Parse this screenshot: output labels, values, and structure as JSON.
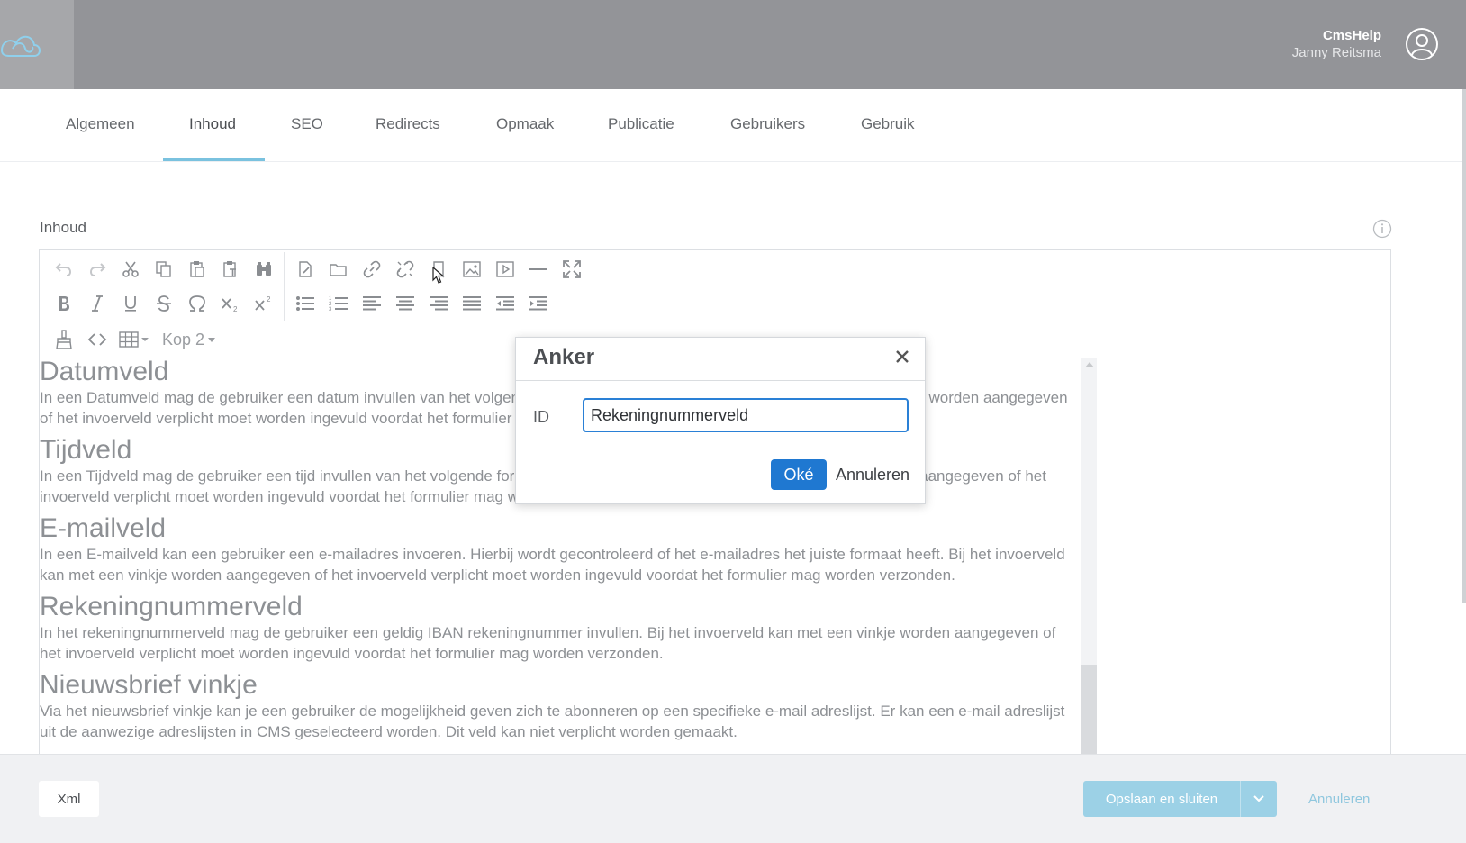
{
  "header": {
    "app_name": "CmsHelp",
    "user_name": "Janny Reitsma"
  },
  "tabs": [
    {
      "label": "Algemeen",
      "active": false
    },
    {
      "label": "Inhoud",
      "active": true
    },
    {
      "label": "SEO",
      "active": false
    },
    {
      "label": "Redirects",
      "active": false
    },
    {
      "label": "Opmaak",
      "active": false
    },
    {
      "label": "Publicatie",
      "active": false
    },
    {
      "label": "Gebruikers",
      "active": false
    },
    {
      "label": "Gebruik",
      "active": false
    }
  ],
  "section": {
    "label": "Inhoud"
  },
  "editor": {
    "toolbar_row1": [
      "undo-icon",
      "redo-icon",
      "cut-icon",
      "copy-icon",
      "paste-icon",
      "paste-text-icon",
      "find-icon",
      "new-document-icon",
      "folder-icon",
      "link-icon",
      "unlink-icon",
      "anchor-icon",
      "image-icon",
      "media-icon",
      "horizontal-rule-icon",
      "fullscreen-icon"
    ],
    "toolbar_row2": [
      "bold-icon",
      "italic-icon",
      "underline-icon",
      "strikethrough-icon",
      "omega-icon",
      "subscript-icon",
      "superscript-icon",
      "bullet-list-icon",
      "numbered-list-icon",
      "align-left-icon",
      "align-center-icon",
      "align-right-icon",
      "justify-icon",
      "outdent-icon",
      "indent-icon"
    ],
    "toolbar_row3": [
      "clean-icon",
      "source-code-icon",
      "table-icon"
    ],
    "format_value": "Kop 2",
    "blocks": [
      {
        "heading": "Datumveld",
        "text": "In een Datumveld mag de gebruiker een datum invullen van het volgende formaat: dd-mm-jjjj. Bij het invoerveld kan met een vinkje worden aangegeven of het invoerveld verplicht moet worden ingevuld voordat het formulier mag worden verzonden."
      },
      {
        "heading": "Tijdveld",
        "text": "In een Tijdveld mag de gebruiker een tijd invullen van het volgende formaat: uu:mm. Bij het invoerveld kan met een vinkje worden aangegeven of het invoerveld verplicht moet worden ingevuld voordat het formulier mag worden verzonden."
      },
      {
        "heading": "E-mailveld",
        "text": "In een E-mailveld kan een gebruiker een e-mailadres invoeren. Hierbij wordt gecontroleerd of het e-mailadres het juiste formaat heeft. Bij het invoerveld kan met een vinkje worden aangegeven of het invoerveld verplicht moet worden ingevuld voordat het formulier mag worden verzonden."
      },
      {
        "heading": "Rekeningnummerveld",
        "text": "In het rekeningnummerveld mag de gebruiker een geldig IBAN rekeningnummer invullen. Bij het invoerveld kan met een vinkje worden aangegeven of het invoerveld verplicht moet worden ingevuld voordat het formulier mag worden verzonden."
      },
      {
        "heading": "Nieuwsbrief vinkje",
        "text": "Via het nieuwsbrief vinkje kan je een gebruiker de mogelijkheid geven zich te abonneren op een specifieke e-mail adreslijst. Er kan een e-mail adreslijst uit de aanwezige adreslijsten in CMS geselecteerd worden. Dit veld kan niet verplicht worden gemaakt."
      }
    ]
  },
  "dialog": {
    "title": "Anker",
    "id_label": "ID",
    "id_value": "Rekeningnummerveld",
    "ok_label": "Oké",
    "cancel_label": "Annuleren"
  },
  "footer": {
    "xml_label": "Xml",
    "save_label": "Opslaan en sluiten",
    "cancel_label": "Annuleren"
  },
  "colors": {
    "header_bg": "#939498",
    "active_tab_underline": "#7ac2df",
    "primary_button": "#1f78d1",
    "save_button": "#9cd1e6"
  }
}
